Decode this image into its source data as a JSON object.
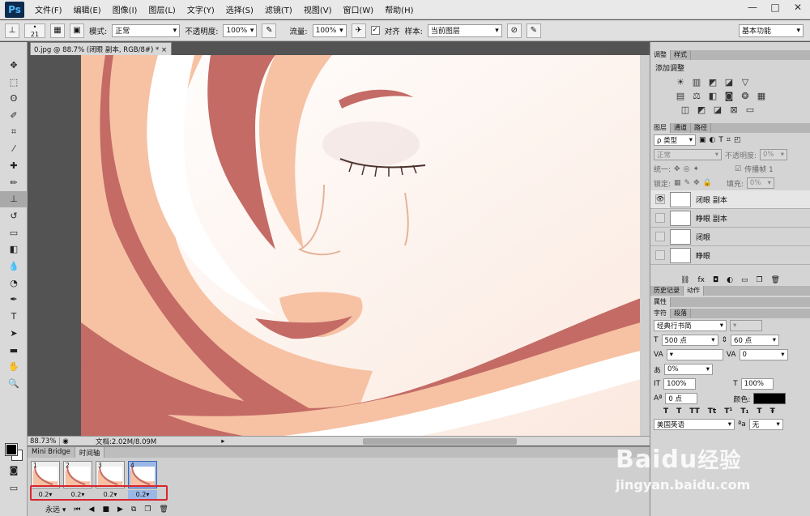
{
  "app": {
    "logo": "Ps"
  },
  "menu": [
    "文件(F)",
    "编辑(E)",
    "图像(I)",
    "图层(L)",
    "文字(Y)",
    "选择(S)",
    "滤镜(T)",
    "视图(V)",
    "窗口(W)",
    "帮助(H)"
  ],
  "window_controls": {
    "minimize": "—",
    "restore": "□",
    "close": "✕"
  },
  "options": {
    "brush_size": "21",
    "mode_label": "模式:",
    "mode_value": "正常",
    "opacity_label": "不透明度:",
    "opacity_value": "100%",
    "flow_label": "流量:",
    "flow_value": "100%",
    "align_label": "对齐",
    "sample_label": "样本:",
    "sample_value": "当前图层",
    "workspace": "基本功能"
  },
  "document": {
    "tab_title": "0.jpg @ 88.7% (闭眼 副本, RGB/8#) *",
    "zoom": "88.73%",
    "doc_size": "文档:2.02M/8.09M"
  },
  "timeline": {
    "tabs": [
      "Mini Bridge",
      "时间轴"
    ],
    "frames": [
      {
        "num": "1",
        "delay": "0.2"
      },
      {
        "num": "2",
        "delay": "0.2"
      },
      {
        "num": "3",
        "delay": "0.2"
      },
      {
        "num": "4",
        "delay": "0.2"
      }
    ],
    "loop": "永远"
  },
  "adjust_panel": {
    "tabs": [
      "调整",
      "样式"
    ],
    "title": "添加调整"
  },
  "layers_panel": {
    "tabs": [
      "图层",
      "通道",
      "路径"
    ],
    "filter": "ρ 类型",
    "blend": "正常",
    "opacity_label": "不透明度:",
    "opacity_value": "0%",
    "unify_label": "统一:",
    "propagate": "传播帧 1",
    "lock_label": "锁定:",
    "fill_label": "填充:",
    "fill_value": "0%",
    "layers": [
      {
        "name": "闭眼 副本",
        "visible": true
      },
      {
        "name": "睁眼 副本",
        "visible": false
      },
      {
        "name": "闭眼",
        "visible": false
      },
      {
        "name": "睁眼",
        "visible": false
      }
    ]
  },
  "history_panel": {
    "tabs": [
      "历史记录",
      "动作"
    ]
  },
  "properties_panel": {
    "title": "属性"
  },
  "char_panel": {
    "tabs": [
      "字符",
      "段落"
    ],
    "font": "经典行书简",
    "size": "500 点",
    "leading": "60 点",
    "tracking": "0",
    "kerning_pct": "0%",
    "v_scale": "100%",
    "h_scale": "100%",
    "baseline": "0 点",
    "color_label": "颜色:",
    "language": "美国英语",
    "aa_label": "ªa",
    "aa_value": "无"
  },
  "watermark": {
    "brand": "Baidu",
    "cn": "经验",
    "url": "jingyan.baidu.com"
  }
}
